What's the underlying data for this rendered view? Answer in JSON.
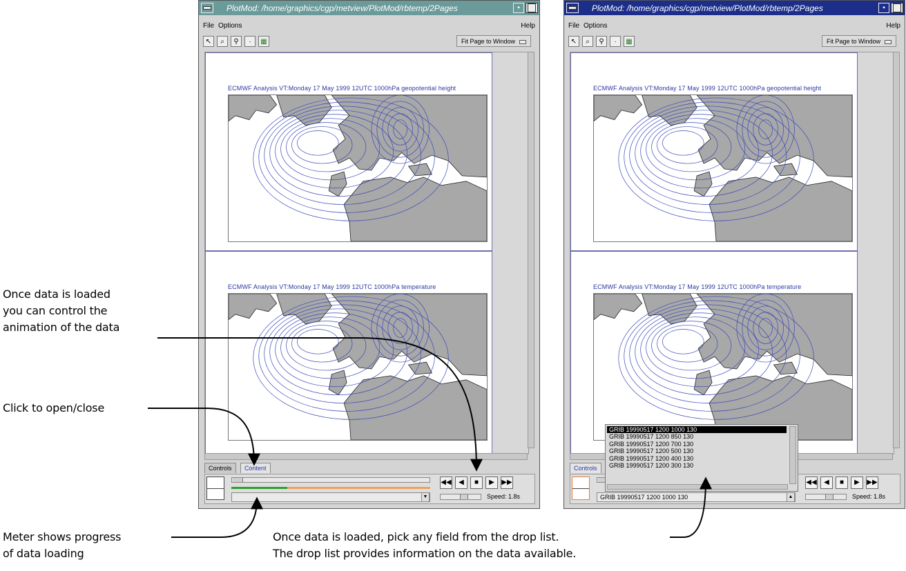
{
  "window_left": {
    "title": "PlotMod: /home/graphics/cgp/metview/PlotMod/rbtemp/2Pages",
    "menu": {
      "file": "File",
      "options": "Options",
      "help": "Help"
    },
    "fit_button": "Fit Page to Window",
    "pages": [
      {
        "title": "ECMWF  Analysis VT:Monday 17 May 1999 12UTC 1000hPa geopotential height"
      },
      {
        "title": "ECMWF  Analysis VT:Monday 17 May 1999 12UTC 1000hPa temperature"
      }
    ],
    "tabs": [
      "Controls",
      "Content"
    ],
    "selected_tab": "Content",
    "meter_progress": 0.28,
    "speed_label": "Speed:  1.8s"
  },
  "window_right": {
    "title": "PlotMod: /home/graphics/cgp/metview/PlotMod/rbtemp/2Pages",
    "menu": {
      "file": "File",
      "options": "Options",
      "help": "Help"
    },
    "fit_button": "Fit Page to Window",
    "pages": [
      {
        "title": "ECMWF  Analysis VT:Monday 17 May 1999 12UTC 1000hPa geopotential height"
      },
      {
        "title": "ECMWF  Analysis VT:Monday 17 May 1999 12UTC 1000hPa temperature"
      }
    ],
    "tabs": [
      "Controls"
    ],
    "selected_tab": "Controls",
    "selected_field": "GRIB 19990517 1200 1000 130",
    "drop_list": [
      "GRIB 19990517 1200 1000 130",
      "GRIB 19990517 1200 850 130",
      "GRIB 19990517 1200 700 130",
      "GRIB 19990517 1200 500 130",
      "GRIB 19990517 1200 400 130",
      "GRIB 19990517 1200 300 130"
    ],
    "speed_label": "Speed:  1.8s"
  },
  "annotations": {
    "animation": [
      "Once data is loaded",
      "you can control the",
      "animation of the data"
    ],
    "open_close": "Click to open/close",
    "meter": [
      "Meter shows progress",
      "of data loading"
    ],
    "droplist": [
      "Once data is loaded, pick any field from the drop list.",
      "The drop list provides information on the data available."
    ]
  },
  "icons": {
    "animation_buttons": [
      "rewind-icon",
      "step-back-icon",
      "stop-icon",
      "step-forward-icon",
      "fast-forward-icon"
    ],
    "tools": [
      "pointer-icon",
      "zoom-icon",
      "magnify-icon",
      "point-icon",
      "grid-icon"
    ]
  },
  "colors": {
    "title_inactive": "#6a9a9a",
    "title_active": "#1c2e8a",
    "contour": "#3a48b8",
    "land": "#a8a8a8"
  }
}
